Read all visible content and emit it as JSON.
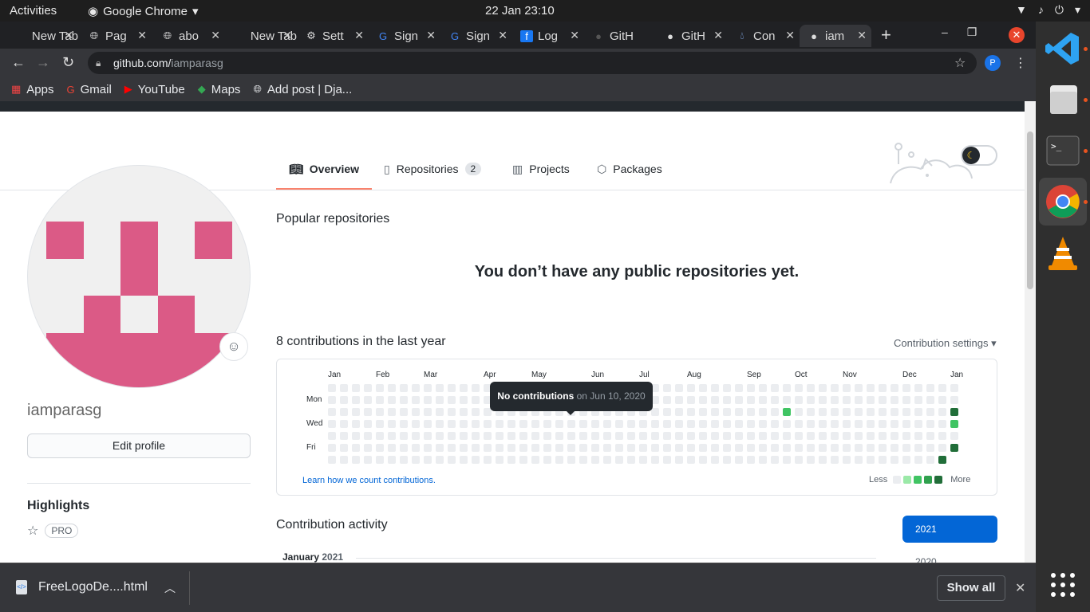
{
  "topbar": {
    "activities": "Activities",
    "app": "Google Chrome",
    "clock": "22 Jan  23:10"
  },
  "tabs": [
    {
      "label": "New Tab",
      "icon": "blank-icon"
    },
    {
      "label": "Pag",
      "icon": "globe-icon"
    },
    {
      "label": "abo",
      "icon": "globe-icon"
    },
    {
      "label": "New Tab",
      "icon": "blank-icon"
    },
    {
      "label": "Sett",
      "icon": "gear-icon"
    },
    {
      "label": "Sign",
      "icon": "google-icon"
    },
    {
      "label": "Sign",
      "icon": "google-icon"
    },
    {
      "label": "Log",
      "icon": "facebook-icon"
    },
    {
      "label": "GitH",
      "icon": "github-icon"
    },
    {
      "label": "GitH",
      "icon": "github-icon"
    },
    {
      "label": "Con",
      "icon": "drop-icon"
    },
    {
      "label": "iam",
      "icon": "github-icon"
    }
  ],
  "toolbar": {
    "url_host": "github.com/",
    "url_path": "iamparasg",
    "profile_initial": "P"
  },
  "bookmarks": [
    {
      "label": "Apps",
      "icon": "apps-grid-icon"
    },
    {
      "label": "Gmail",
      "icon": "google-icon"
    },
    {
      "label": "YouTube",
      "icon": "youtube-icon"
    },
    {
      "label": "Maps",
      "icon": "maps-icon"
    },
    {
      "label": "Add post | Dja...",
      "icon": "globe-icon"
    }
  ],
  "nav": {
    "overview": "Overview",
    "repositories": "Repositories",
    "repositories_count": "2",
    "projects": "Projects",
    "packages": "Packages"
  },
  "profile": {
    "username": "iamparasg",
    "edit_profile": "Edit profile",
    "highlights": "Highlights",
    "pro_badge": "PRO",
    "avatar_color": "#db5a86"
  },
  "main": {
    "popular_title": "Popular repositories",
    "no_repos": "You don’t have any public repositories yet.",
    "contrib_count_text": "8 contributions in the last year",
    "contrib_settings": "Contribution settings ▾",
    "learn_link": "Learn how we count contributions.",
    "legend_less": "Less",
    "legend_more": "More",
    "activity_title": "Contribution activity",
    "year_selected": "2021",
    "year_other": "2020",
    "month_heading": "January",
    "month_year": "2021"
  },
  "graph": {
    "months": [
      "Jan",
      "Feb",
      "Mar",
      "Apr",
      "May",
      "Jun",
      "Jul",
      "Aug",
      "Sep",
      "Oct",
      "Nov",
      "Dec",
      "Jan"
    ],
    "days": [
      "Mon",
      "Wed",
      "Fri"
    ],
    "weeks": 53,
    "levels": [
      "#ebedf0",
      "#9be9a8",
      "#40c463",
      "#30a14e",
      "#216e39"
    ],
    "active_cells": [
      {
        "week": 38,
        "day": 2,
        "level": 2
      },
      {
        "week": 52,
        "day": 2,
        "level": 4
      },
      {
        "week": 52,
        "day": 3,
        "level": 2
      },
      {
        "week": 52,
        "day": 5,
        "level": 4
      },
      {
        "week": 51,
        "day": 6,
        "level": 4
      }
    ]
  },
  "tooltip": {
    "bold": "No contributions",
    "rest": " on Jun 10, 2020"
  },
  "download": {
    "filename": "FreeLogoDe....html",
    "show_all": "Show all"
  }
}
